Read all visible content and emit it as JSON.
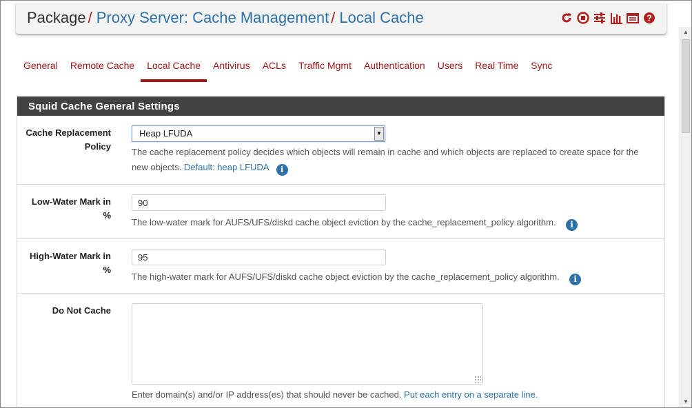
{
  "header": {
    "crumbs": [
      "Package",
      "Proxy Server: Cache Management",
      "Local Cache"
    ],
    "separator": "/",
    "icons": [
      "reload-icon",
      "stop-icon",
      "sliders-icon",
      "chart-icon",
      "log-icon",
      "help-icon"
    ]
  },
  "tabs": [
    "General",
    "Remote Cache",
    "Local Cache",
    "Antivirus",
    "ACLs",
    "Traffic Mgmt",
    "Authentication",
    "Users",
    "Real Time",
    "Sync"
  ],
  "active_tab": "Local Cache",
  "panel": {
    "title": "Squid Cache General Settings",
    "fields": {
      "policy": {
        "label": "Cache Replacement Policy",
        "value": "Heap LFUDA",
        "help": "The cache replacement policy decides which objects will remain in cache and which objects are replaced to create space for the new objects.",
        "help_link": "Default: heap LFUDA"
      },
      "low": {
        "label": "Low-Water Mark in %",
        "value": "90",
        "help": "The low-water mark for AUFS/UFS/diskd cache object eviction by the cache_replacement_policy algorithm."
      },
      "high": {
        "label": "High-Water Mark in %",
        "value": "95",
        "help": "The high-water mark for AUFS/UFS/diskd cache object eviction by the cache_replacement_policy algorithm."
      },
      "dnc": {
        "label": "Do Not Cache",
        "value": "",
        "help": "Enter domain(s) and/or IP address(es) that should never be cached.",
        "help_link": "Put each entry on a separate line."
      }
    },
    "info_glyph": "i"
  },
  "colors": {
    "accent": "#a31515",
    "link": "#2c72a8",
    "panel_header": "#424242"
  }
}
